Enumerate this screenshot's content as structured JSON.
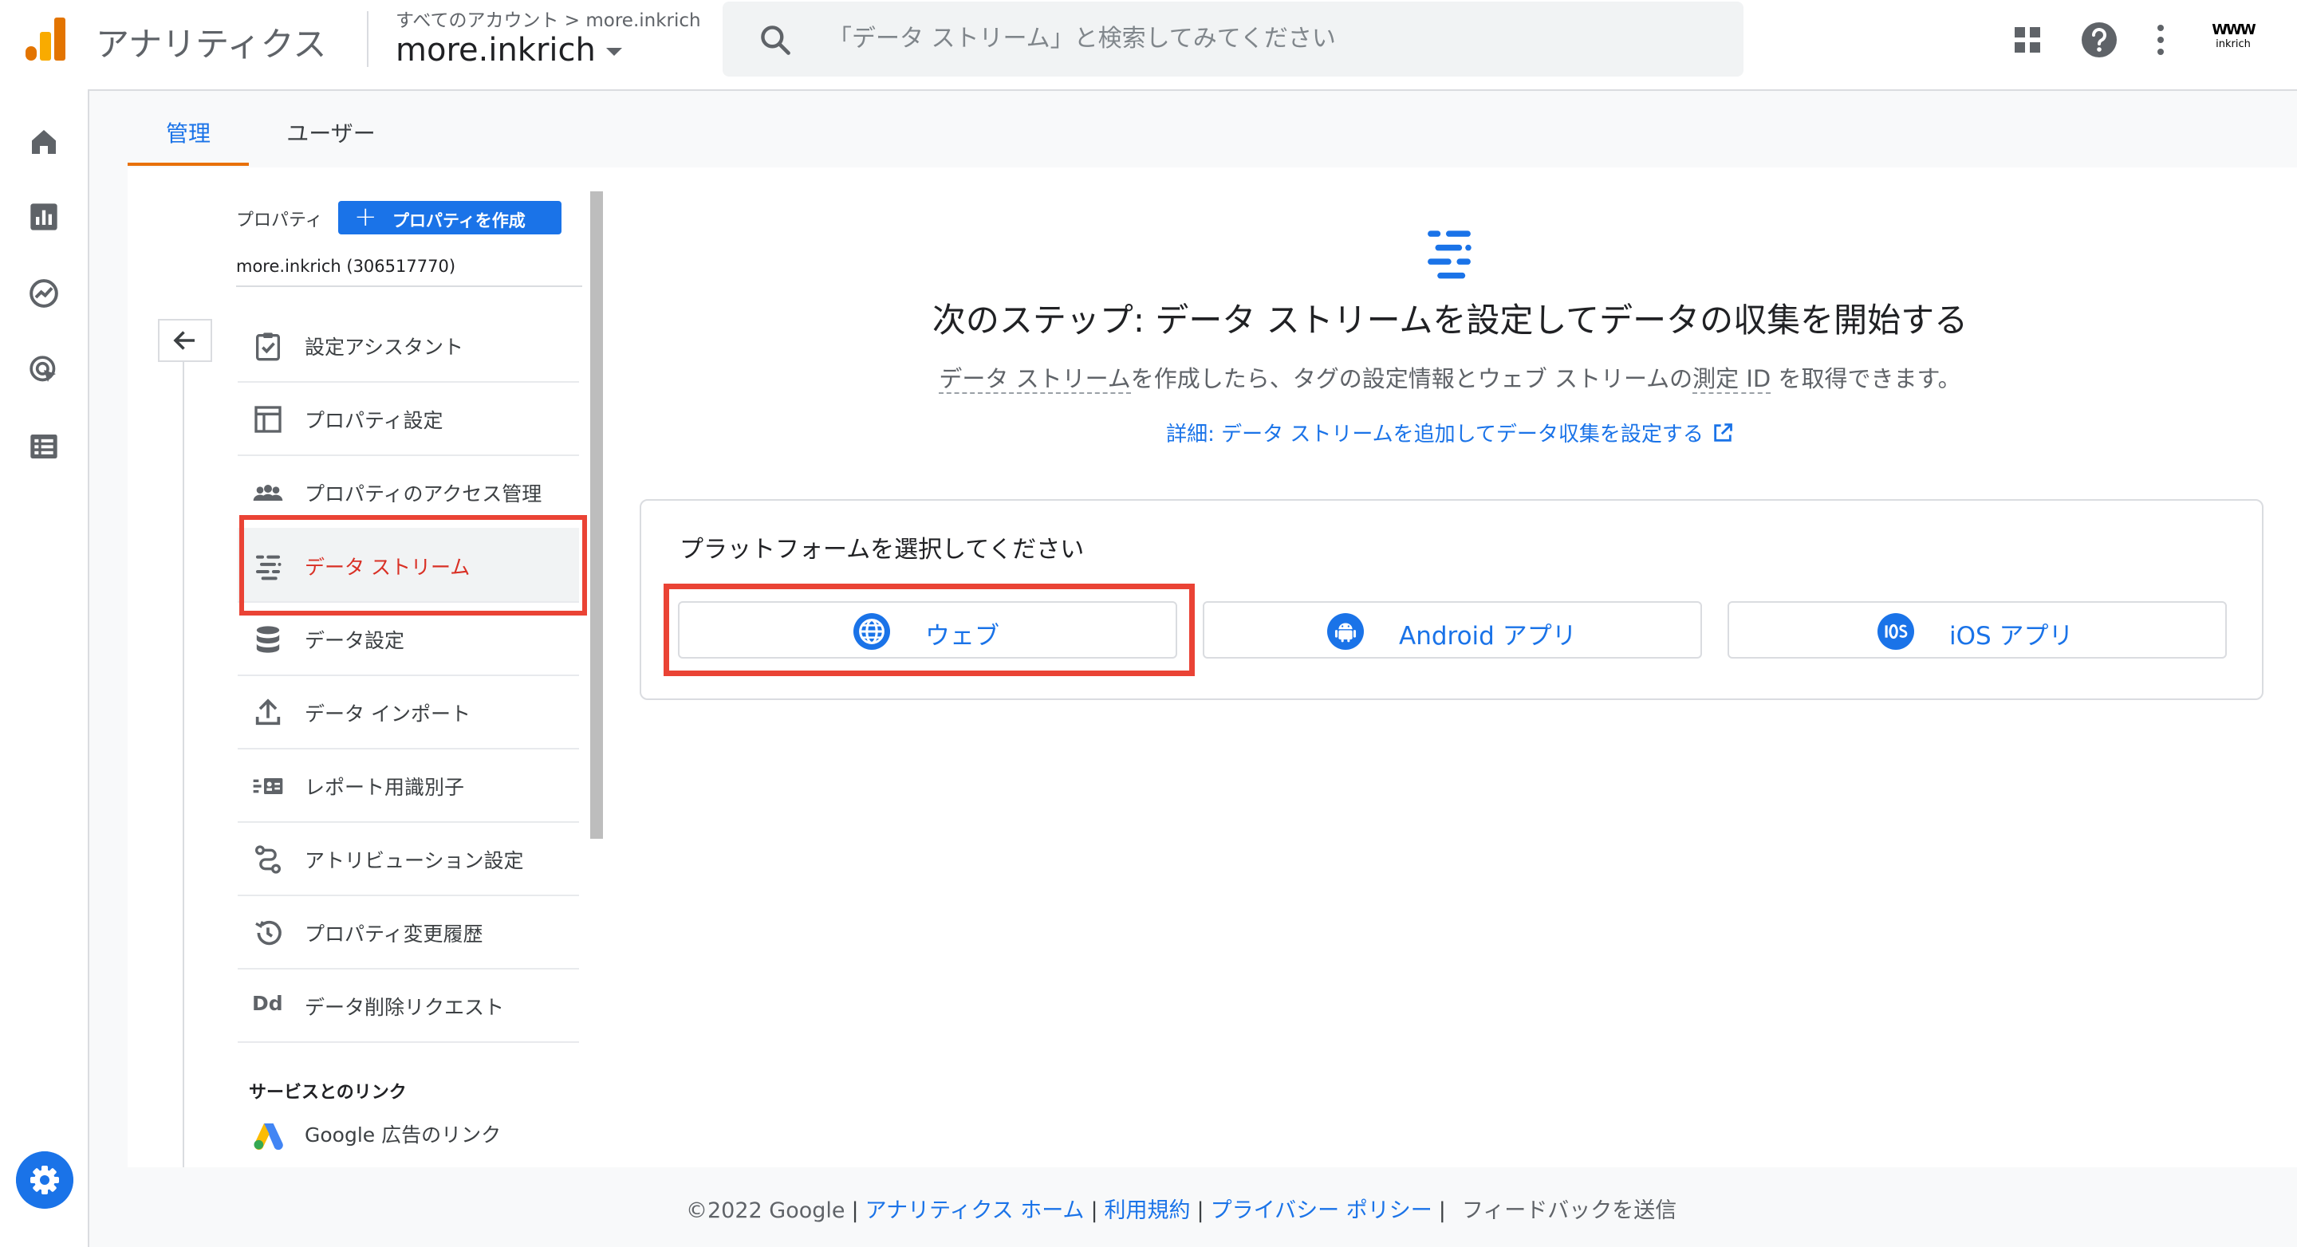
{
  "header": {
    "product_name": "アナリティクス",
    "breadcrumb": "すべてのアカウント > more.inkrich",
    "account_name": "more.inkrich",
    "search_placeholder": "「データ ストリーム」と検索してみてください",
    "brand_mark": "WWW",
    "brand_text": "inkrich"
  },
  "admin_tabs": [
    {
      "label": "管理",
      "active": true
    },
    {
      "label": "ユーザー",
      "active": false
    }
  ],
  "property_panel": {
    "column_label": "プロパティ",
    "create_button": "プロパティを作成",
    "property_id": "more.inkrich (306517770)",
    "menu_items": [
      {
        "label": "設定アシスタント",
        "icon": "checklist-icon"
      },
      {
        "label": "プロパティ設定",
        "icon": "layout-icon"
      },
      {
        "label": "プロパティのアクセス管理",
        "icon": "people-icon"
      },
      {
        "label": "データ ストリーム",
        "icon": "data-stream-icon",
        "active": true
      },
      {
        "label": "データ設定",
        "icon": "database-icon"
      },
      {
        "label": "データ インポート",
        "icon": "upload-icon"
      },
      {
        "label": "レポート用識別子",
        "icon": "identity-icon"
      },
      {
        "label": "アトリビューション設定",
        "icon": "attribution-icon"
      },
      {
        "label": "プロパティ変更履歴",
        "icon": "history-icon"
      },
      {
        "label": "データ削除リクエスト",
        "icon": "dd-icon"
      }
    ],
    "links_section_title": "サービスとのリンク",
    "google_ads_link": "Google 広告のリンク"
  },
  "main": {
    "heading": "次のステップ: データ ストリームを設定してデータの収集を開始する",
    "subtext_term1": "データ ストリーム",
    "subtext_mid": "を作成したら、タグの設定情報とウェブ ストリームの",
    "subtext_term2": "測定 ID",
    "subtext_end": " を取得できます。",
    "learn_more_link": "詳細: データ ストリームを追加してデータ収集を設定する",
    "platform_title": "プラットフォームを選択してください",
    "platforms": [
      {
        "label": "ウェブ",
        "icon": "globe-icon"
      },
      {
        "label": "Android アプリ",
        "icon": "android-icon"
      },
      {
        "label": "iOS アプリ",
        "icon": "ios-icon"
      }
    ]
  },
  "footer": {
    "copyright": "©2022 Google",
    "links": [
      "アナリティクス ホーム",
      "利用規約",
      "プライバシー ポリシー"
    ],
    "feedback": "フィードバックを送信"
  },
  "colors": {
    "accent_blue": "#1a73e8",
    "tab_underline_orange": "#e8710a",
    "highlight_red": "#ea4335",
    "active_text_red": "#d93025"
  }
}
